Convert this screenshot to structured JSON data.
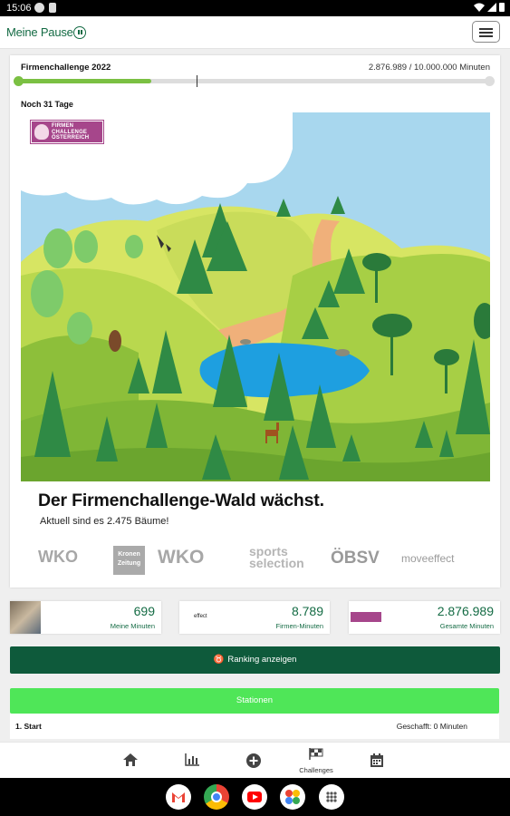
{
  "status_bar": {
    "time": "15:06"
  },
  "header": {
    "brand": "Meine Pause",
    "menu_icon": "hamburger-icon"
  },
  "challenge": {
    "title": "Firmenchallenge 2022",
    "progress_text": "2.876.989 / 10.000.000 Minuten",
    "progress_fraction": 0.288,
    "days_left": "Noch 31 Tage",
    "logo_text": "FIRMEN CHALLENGE ÖSTERREICH",
    "headline": "Der Firmenchallenge-Wald wächst.",
    "subline": "Aktuell sind es 2.475 Bäume!",
    "sponsors": [
      "WKO",
      "Kronen Zeitung",
      "WKO",
      "sports selection",
      "ÖBSV",
      "moveeffect"
    ]
  },
  "stats": [
    {
      "value": "699",
      "label": "Meine Minuten"
    },
    {
      "value": "8.789",
      "label": "Firmen-Minuten",
      "logo_text": "effect"
    },
    {
      "value": "2.876.989",
      "label": "Gesamte Minuten"
    }
  ],
  "ranking_button": "Ranking anzeigen",
  "stations_button": "Stationen",
  "station": {
    "name": "1. Start",
    "status": "Geschafft: 0 Minuten"
  },
  "nav": {
    "home": "",
    "stats": "",
    "add": "",
    "challenges": "Challenges",
    "calendar": ""
  },
  "colors": {
    "brand_green": "#146b44",
    "progress_green": "#7bc043",
    "ranking_bg": "#0e5a3b",
    "stations_bg": "#4fe658"
  }
}
